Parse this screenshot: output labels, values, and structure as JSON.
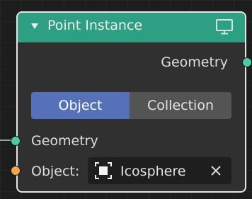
{
  "node": {
    "title": "Point Instance",
    "output": {
      "label": "Geometry"
    },
    "instance_type": {
      "options": [
        "Object",
        "Collection"
      ],
      "selected": "Object"
    },
    "inputs": {
      "geometry_label": "Geometry",
      "object_label": "Object:",
      "object_value": "Icosphere"
    },
    "icons": {
      "collapse": "chevron-down-icon",
      "preview": "monitor-icon",
      "object": "object-cube-icon",
      "clear": "close-icon"
    }
  },
  "colors": {
    "header": "#2f9f84",
    "geometry_socket": "#4ec9a7",
    "object_socket": "#f4a647",
    "selected_toggle": "#5671b7"
  }
}
